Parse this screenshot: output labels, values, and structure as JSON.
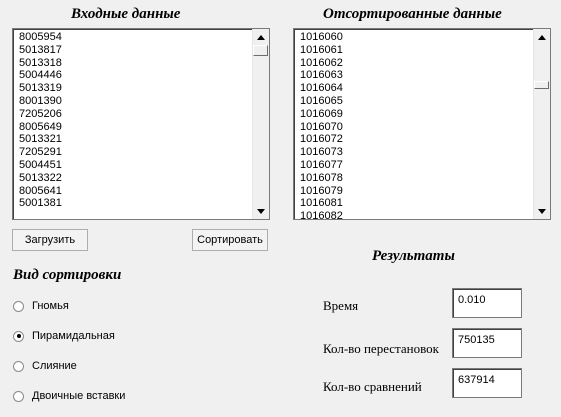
{
  "input_panel": {
    "title": "Входные данные",
    "items": [
      "8005954",
      "5013817",
      "5013318",
      "5004446",
      "5013319",
      "8001390",
      "7205206",
      "8005649",
      "5013321",
      "7205291",
      "5004451",
      "5013322",
      "8005641",
      "5001381"
    ]
  },
  "sorted_panel": {
    "title": "Отсортированные данные",
    "items": [
      "1016060",
      "1016061",
      "1016062",
      "1016063",
      "1016064",
      "1016065",
      "1016069",
      "1016070",
      "1016072",
      "1016073",
      "1016077",
      "1016078",
      "1016079",
      "1016081",
      "1016082"
    ]
  },
  "buttons": {
    "load": "Загрузить",
    "sort": "Сортировать"
  },
  "sort_type": {
    "title": "Вид сортировки",
    "selected": "Пирамидальная",
    "options": [
      "Гномья",
      "Пирамидальная",
      "Слияние",
      "Двоичные вставки"
    ]
  },
  "results": {
    "title": "Результаты",
    "time_label": "Время",
    "time_value": "0.010",
    "swaps_label": "Кол-во перестановок",
    "swaps_value": "750135",
    "comparisons_label": "Кол-во сравнений",
    "comparisons_value": "637914"
  }
}
